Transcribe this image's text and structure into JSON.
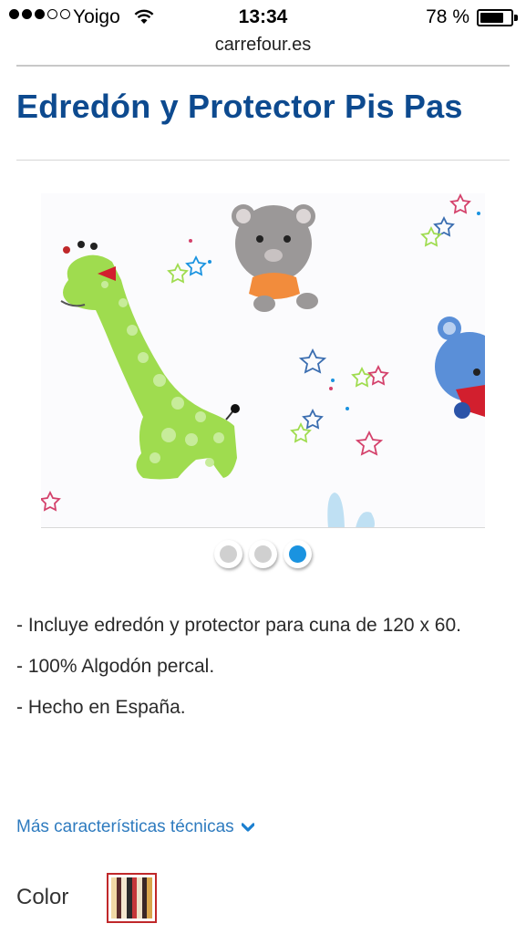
{
  "status_bar": {
    "carrier": "Yoigo",
    "signal_bars_filled": 3,
    "signal_bars_total": 5,
    "time": "13:34",
    "battery_percent_label": "78 %",
    "battery_level": 0.78,
    "wifi_icon": "wifi-icon",
    "battery_icon": "battery-icon"
  },
  "browser": {
    "url": "carrefour.es"
  },
  "product": {
    "title": "Edredón y Protector Pis Pas",
    "gallery": {
      "image_icon": "product-photo",
      "slides_total": 3,
      "active_slide": 3
    },
    "features": [
      "- Incluye edredón y protector para cuna de 120 x 60.",
      "- 100% Algodón percal.",
      "- Hecho en España."
    ],
    "more_link": "Más características técnicas",
    "more_icon": "chevron-down-icon",
    "color_label": "Color"
  },
  "colors": {
    "title": "#0d4a8f",
    "link": "#2e7bbf",
    "active_dot": "#1a93e0",
    "swatch_border": "#c0282a"
  }
}
